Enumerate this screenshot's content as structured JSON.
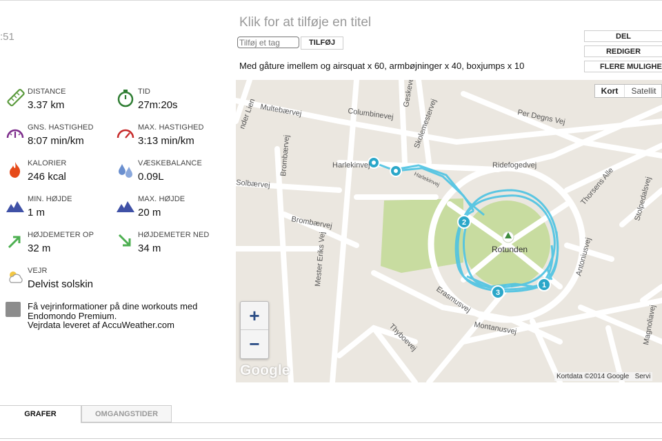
{
  "clock": ":51",
  "workout": {
    "title_placeholder": "Klik for at tilføje en titel",
    "tag_placeholder": "Tilføj et tag",
    "add_tag_label": "TILFØJ",
    "description": "Med gåture imellem og airsquat x 60, armbøjninger x 40, boxjumps x 10"
  },
  "actions": {
    "share": "DEL",
    "edit": "REDIGER",
    "more": "FLERE MULIGHEDER"
  },
  "stats": [
    {
      "icon": "ruler-icon",
      "label": "DISTANCE",
      "value": "3.37 km"
    },
    {
      "icon": "stopwatch-icon",
      "label": "TID",
      "value": "27m:20s"
    },
    {
      "icon": "speedometer-icon",
      "label": "GNS. HASTIGHED",
      "value": "8:07 min/km"
    },
    {
      "icon": "speedometer-max-icon",
      "label": "MAX. HASTIGHED",
      "value": "3:13 min/km"
    },
    {
      "icon": "flame-icon",
      "label": "KALORIER",
      "value": "246 kcal"
    },
    {
      "icon": "water-drops-icon",
      "label": "VÆSKEBALANCE",
      "value": "0.09L"
    },
    {
      "icon": "mountain-icon",
      "label": "MIN. HØJDE",
      "value": "1 m"
    },
    {
      "icon": "mountain-icon",
      "label": "MAX. HØJDE",
      "value": "20 m"
    },
    {
      "icon": "arrow-up-right-icon",
      "label": "HØJDEMETER OP",
      "value": "32 m"
    },
    {
      "icon": "arrow-down-right-icon",
      "label": "HØJDEMETER NED",
      "value": "34 m"
    },
    {
      "icon": "partly-cloudy-icon",
      "label": "VEJR",
      "value": "Delvist solskin"
    }
  ],
  "weather_promo": {
    "line1": "Få vejrinformationer på dine workouts med",
    "line2": "Endomondo Premium.",
    "line3": "Vejrdata leveret af AccuWeather.com"
  },
  "map": {
    "type_options": [
      "Kort",
      "Satellit"
    ],
    "selected_type": "Kort",
    "zoom_in": "+",
    "zoom_out": "−",
    "google_mark": "Google",
    "credit": "Kortdata ©2014 Google",
    "terms": "Servi",
    "place_name": "Rotunden",
    "streets": [
      "Multebærvej",
      "Columbinevej",
      "Geskevej",
      "Skolemestervej",
      "Per Degns Vej",
      "Ridefogedvej",
      "Thorsens Alle",
      "Stolpedalsvej",
      "Antoniusvej",
      "Magnoliavej",
      "Montanusvej",
      "Erasmusvej",
      "Thyboevej",
      "Mester Eriks Vej",
      "Brombærvej",
      "Solbærvej",
      "Harlekinvej",
      "nder Lien"
    ],
    "route_color": "#4cc3e3",
    "lap_markers": [
      "1",
      "2",
      "3"
    ]
  },
  "tabs": [
    "GRAFER",
    "OMGANGSTIDER"
  ]
}
